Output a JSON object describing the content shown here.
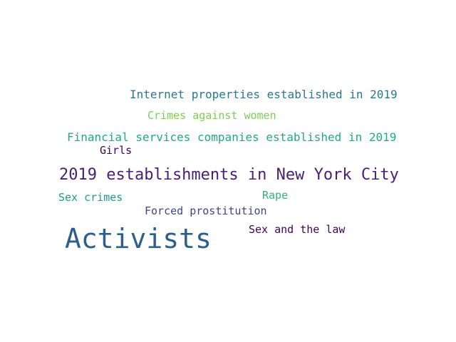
{
  "words": [
    {
      "text": "Internet properties established in 2019",
      "color": "#2a788e",
      "weight": 0.45
    },
    {
      "text": "Crimes against women",
      "color": "#7ad151",
      "weight": 0.4
    },
    {
      "text": "Financial services companies established in 2019",
      "color": "#22a884",
      "weight": 0.45
    },
    {
      "text": "Girls",
      "color": "#440154",
      "weight": 0.4
    },
    {
      "text": "2019 establishments in New York City",
      "color": "#482173",
      "weight": 0.6
    },
    {
      "text": "Sex crimes",
      "color": "#1f9a8a",
      "weight": 0.4
    },
    {
      "text": "Rape",
      "color": "#2fb47c",
      "weight": 0.4
    },
    {
      "text": "Forced prostitution",
      "color": "#414487",
      "weight": 0.4
    },
    {
      "text": "Sex and the law",
      "color": "#440154",
      "weight": 0.4
    },
    {
      "text": "Activists",
      "color": "#2c5f8a",
      "weight": 1.0
    }
  ]
}
